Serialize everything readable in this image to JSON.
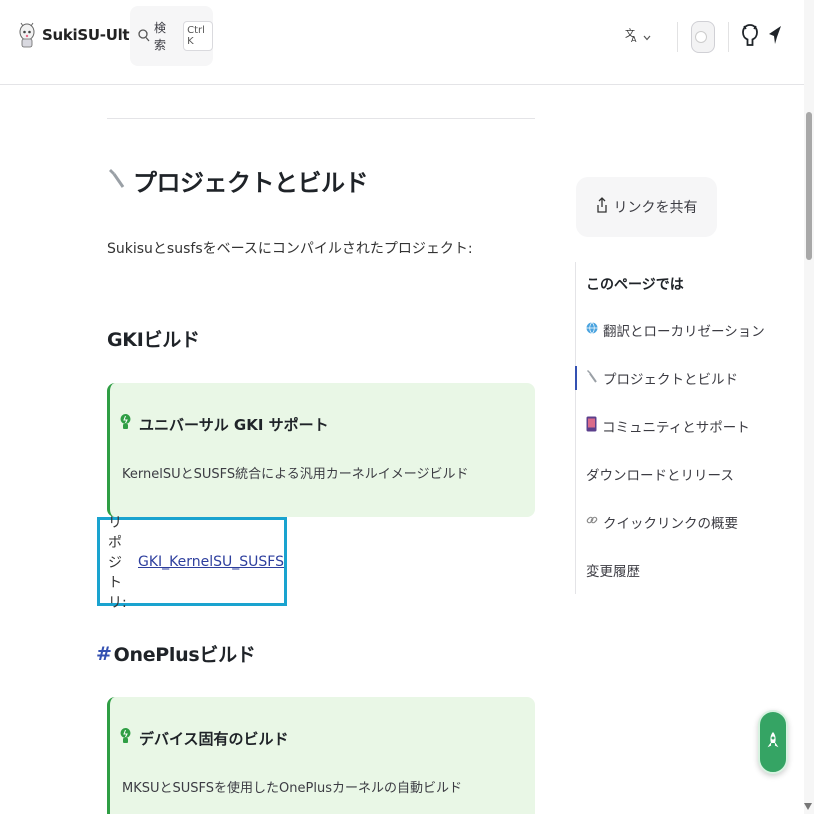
{
  "header": {
    "site_title": "SukiSU-Ultra",
    "search_label": "検索",
    "search_kbd": "Ctrl K",
    "lang_icon": "translate-icon"
  },
  "main": {
    "section_title": "プロジェクトとビルド",
    "section_icon": "wrench-icon",
    "intro": "Sukisuとsusfsをベースにコンパイルされたプロジェクト:",
    "gki": {
      "heading": "GKIビルド",
      "tip_title": "ユニバーサル GKI サポート",
      "tip_desc": "KernelSUとSUSFS統合による汎用カーネルイメージビルド",
      "repo_label": "リポジトリ:",
      "repo_link": "GKI_KernelSU_SUSFS"
    },
    "oneplus": {
      "hash": "#",
      "heading": "OnePlusビルド",
      "tip_title": "デバイス固有のビルド",
      "tip_desc": "MKSUとSUSFSを使用したOnePlusカーネルの自動ビルド"
    }
  },
  "aside": {
    "share_label": "リンクを共有",
    "toc_title": "このページでは",
    "toc_items": [
      {
        "label": "翻訳とローカリゼーション",
        "icon": "globe-icon"
      },
      {
        "label": "プロジェクトとビルド",
        "icon": "wrench-icon"
      },
      {
        "label": "コミュニティとサポート",
        "icon": "phone-icon"
      },
      {
        "label": "ダウンロードとリリース",
        "icon": ""
      },
      {
        "label": "クイックリンクの概要",
        "icon": "link-icon"
      },
      {
        "label": "変更履歴",
        "icon": ""
      }
    ]
  },
  "colors": {
    "accent": "#3451b2",
    "tip_bg": "#e9f7e6",
    "tip_border": "#2f9e44",
    "highlight_box": "#1aa3cf",
    "fab": "#35a464"
  }
}
